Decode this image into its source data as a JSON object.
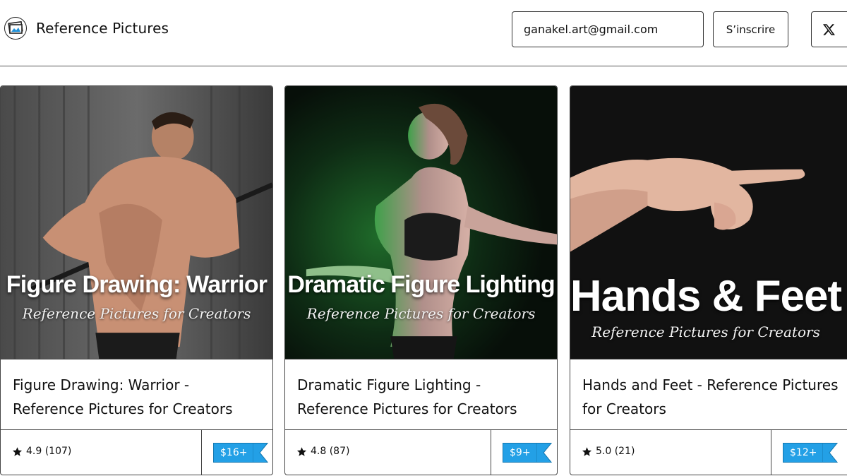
{
  "header": {
    "logo_icon": "photo-frame-logo-icon",
    "title": "Reference Pictures",
    "email_value": "ganakel.art@gmail.com",
    "subscribe_label": "S’inscrire",
    "x_icon": "x-logo-icon"
  },
  "products": [
    {
      "image_title": "Figure Drawing: Warrior",
      "image_subtitle": "Reference Pictures for Creators",
      "name": "Figure Drawing: Warrior - Reference Pictures for Creators",
      "rating": "4.9",
      "reviews": "(107)",
      "price": "$16+"
    },
    {
      "image_title": "Dramatic Figure Lighting",
      "image_subtitle": "Reference Pictures for Creators",
      "name": "Dramatic Figure Lighting - Reference Pictures for Creators",
      "rating": "4.8",
      "reviews": "(87)",
      "price": "$9+"
    },
    {
      "image_title": "Hands & Feet",
      "image_subtitle": "Reference Pictures for Creators",
      "name": "Hands and Feet - Reference Pictures for Creators",
      "rating": "5.0",
      "reviews": "(21)",
      "price": "$12+"
    }
  ],
  "colors": {
    "price_tag": "#23a0e6",
    "border": "#444444"
  }
}
